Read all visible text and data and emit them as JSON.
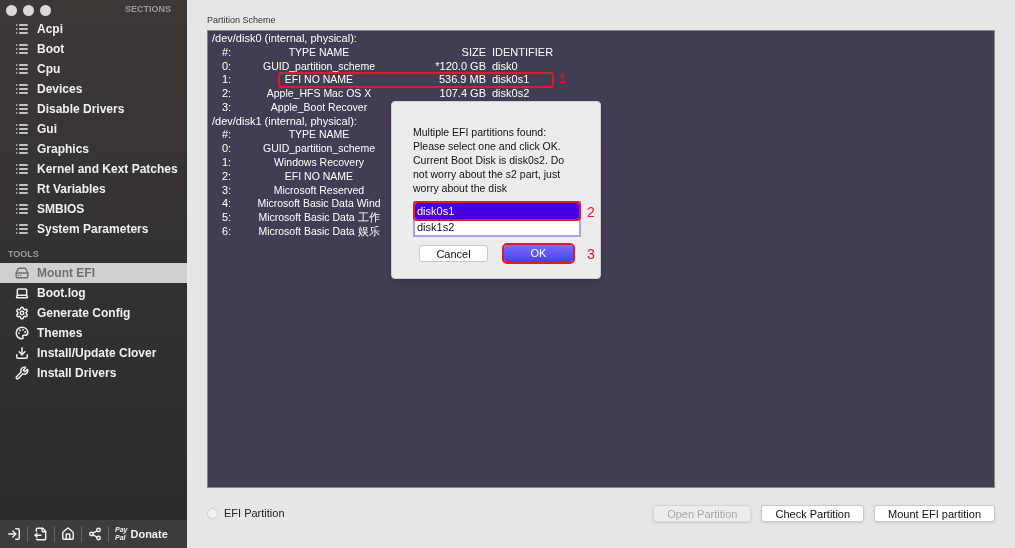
{
  "sidebar": {
    "sections_header": "SECTIONS",
    "sections": [
      {
        "label": "Acpi",
        "selected": false
      },
      {
        "label": "Boot",
        "selected": false
      },
      {
        "label": "Cpu",
        "selected": false
      },
      {
        "label": "Devices",
        "selected": false
      },
      {
        "label": "Disable Drivers",
        "selected": false
      },
      {
        "label": "Gui",
        "selected": false
      },
      {
        "label": "Graphics",
        "selected": false
      },
      {
        "label": "Kernel and Kext Patches",
        "selected": false
      },
      {
        "label": "Rt Variables",
        "selected": false
      },
      {
        "label": "SMBIOS",
        "selected": false
      },
      {
        "label": "System Parameters",
        "selected": false
      }
    ],
    "tools_header": "TOOLS",
    "tools": [
      {
        "label": "Mount EFI",
        "selected": true
      },
      {
        "label": "Boot.log",
        "selected": false
      },
      {
        "label": "Generate Config",
        "selected": false
      },
      {
        "label": "Themes",
        "selected": false
      },
      {
        "label": "Install/Update Clover",
        "selected": false
      },
      {
        "label": "Install Drivers",
        "selected": false
      }
    ],
    "footer": {
      "paypal_top": "Pay",
      "paypal_bottom": "Pal",
      "donate": "Donate"
    }
  },
  "partition_scheme": {
    "title": "Partition Scheme",
    "lines": [
      {
        "kind": "header",
        "text": "/dev/disk0 (internal, physical):"
      },
      {
        "kind": "row",
        "num": "#:",
        "name": "TYPE NAME",
        "size": "SIZE",
        "id": "IDENTIFIER",
        "marked": false
      },
      {
        "kind": "row",
        "num": "0:",
        "name": "GUID_partition_scheme",
        "size": "*120.0 GB",
        "id": "disk0",
        "marked": false
      },
      {
        "kind": "row",
        "num": "1:",
        "name": "EFI NO NAME",
        "size": "536.9 MB",
        "id": "disk0s1",
        "marked": true,
        "mark": "1"
      },
      {
        "kind": "row",
        "num": "2:",
        "name": "Apple_HFS Mac OS X",
        "size": "107.4 GB",
        "id": "disk0s2",
        "marked": false
      },
      {
        "kind": "row",
        "num": "3:",
        "name": "Apple_Boot Recover",
        "marked": false
      },
      {
        "kind": "header",
        "text": "/dev/disk1 (internal, physical):"
      },
      {
        "kind": "row",
        "num": "#:",
        "name": "TYPE NAME",
        "marked": false
      },
      {
        "kind": "row",
        "num": "0:",
        "name": "GUID_partition_scheme",
        "marked": false
      },
      {
        "kind": "row",
        "num": "1:",
        "name": "Windows Recovery",
        "marked": false
      },
      {
        "kind": "row",
        "num": "2:",
        "name": "EFI NO NAME",
        "marked": false
      },
      {
        "kind": "row",
        "num": "3:",
        "name": "Microsoft Reserved",
        "marked": false
      },
      {
        "kind": "row",
        "num": "4:",
        "name": "Microsoft Basic Data Wind",
        "marked": false
      },
      {
        "kind": "row",
        "num": "5:",
        "name": "Microsoft Basic Data 工作",
        "marked": false
      },
      {
        "kind": "row",
        "num": "6:",
        "name": "Microsoft Basic Data 娱乐",
        "marked": false
      }
    ]
  },
  "dialog": {
    "message": "Multiple EFI partitions found: Please select one and click OK. Current Boot Disk is disk0s2. Do not worry about the s2 part, just worry about the disk",
    "options": [
      {
        "label": "disk0s1",
        "selected": true,
        "mark": "2"
      },
      {
        "label": "disk1s2",
        "selected": false
      }
    ],
    "cancel": "Cancel",
    "ok": "OK",
    "ok_mark": "3"
  },
  "efi_partition": {
    "label": "EFI Partition",
    "checked": false
  },
  "buttons": [
    {
      "label": "Open Partition",
      "disabled": true
    },
    {
      "label": "Check Partition",
      "disabled": false
    },
    {
      "label": "Mount EFI partition",
      "disabled": false
    }
  ]
}
